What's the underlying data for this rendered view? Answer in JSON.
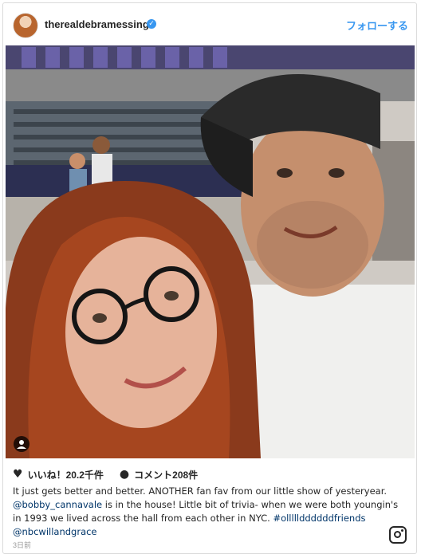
{
  "header": {
    "username": "therealdebramessing",
    "verified_symbol": "✓",
    "follow_label": "フォローする"
  },
  "actions": {
    "like_icon": "heart-icon",
    "like_text": "いいね！20.2千件",
    "comment_icon": "comment-icon",
    "comment_text": "コメント208件"
  },
  "caption": {
    "line1": "It just gets better and better. ANOTHER fan fav from our little show of yesteryear.",
    "mention1": "@bobby_cannavale",
    "line2": " is in the house! Little bit of trivia- when we were both youngin's in 1993 we lived across the hall from each other in NYC. ",
    "hashtag": "#olllllddddddfriends",
    "mention2": "@nbcwillandgrace"
  },
  "timestamp": "3日前",
  "colors": {
    "link": "#3897f0",
    "mention": "#003569",
    "text": "#262626"
  }
}
